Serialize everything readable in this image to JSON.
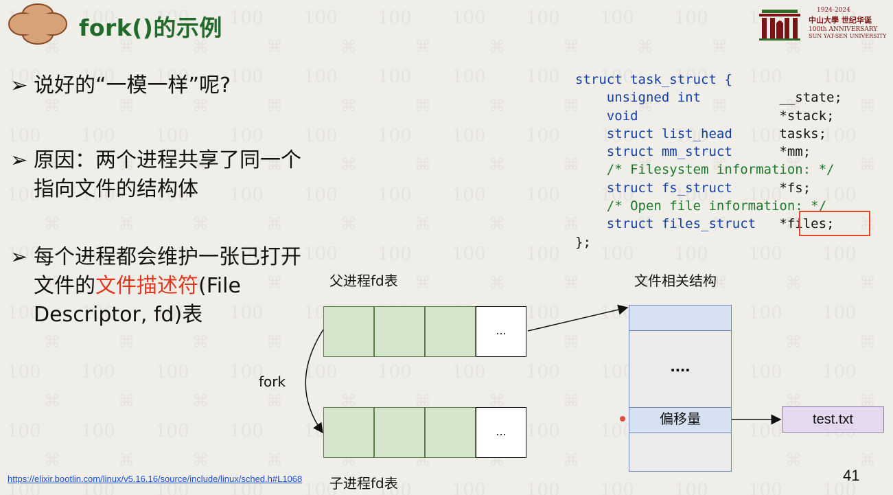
{
  "slide": {
    "title": "fork()的示例",
    "page_number": "41",
    "url": "https://elixir.bootlin.com/linux/v5.16.16/source/include/linux/sched.h#L1068"
  },
  "logo": {
    "years": "1924-2024",
    "name_cn": "中山大學 世纪华诞",
    "anniversary": "100th ANNIVERSARY",
    "university": "SUN YAT-SEN UNIVERSITY"
  },
  "bullets": [
    {
      "arrow": "➢",
      "text": "说好的“一模一样”呢?"
    },
    {
      "arrow": "➢",
      "text": "原因：两个进程共享了同一个指向文件的结构体"
    },
    {
      "arrow": "➢",
      "text_before": "每个进程都会维护一张已打开文件的",
      "highlight": "文件描述符",
      "text_after": "(File Descriptor, fd)表"
    }
  ],
  "code": {
    "lines": [
      {
        "kw": "struct task_struct {",
        "name": "",
        "cmt": ""
      },
      {
        "kw": "    unsigned int",
        "name": "          __state;",
        "cmt": ""
      },
      {
        "kw": "    void",
        "name": "                  *stack;",
        "cmt": ""
      },
      {
        "kw": "    struct list_head",
        "name": "      tasks;",
        "cmt": ""
      },
      {
        "kw": "    struct mm_struct",
        "name": "      *mm;",
        "cmt": ""
      },
      {
        "kw": "",
        "name": "",
        "cmt": "    /* Filesystem information: */"
      },
      {
        "kw": "    struct fs_struct",
        "name": "      *fs;",
        "cmt": ""
      },
      {
        "kw": "",
        "name": "",
        "cmt": "    /* Open file information: */"
      },
      {
        "kw": "    struct files_struct",
        "name": "   *files;",
        "cmt": ""
      },
      {
        "kw": "};",
        "name": "",
        "cmt": ""
      }
    ],
    "highlight_color": "#e2472a"
  },
  "diagram": {
    "parent_label": "父进程fd表",
    "child_label": "子进程fd表",
    "fork_label": "fork",
    "dots_cell": "...",
    "file_struct_label": "文件相关结构",
    "file_dots": "....",
    "offset_label": "偏移量",
    "file_name": "test.txt"
  },
  "colors": {
    "title": "#226a2b",
    "accent": "#e0381f",
    "fd_cell": "#d5e6cc",
    "file_block": "#d6e2f3"
  }
}
